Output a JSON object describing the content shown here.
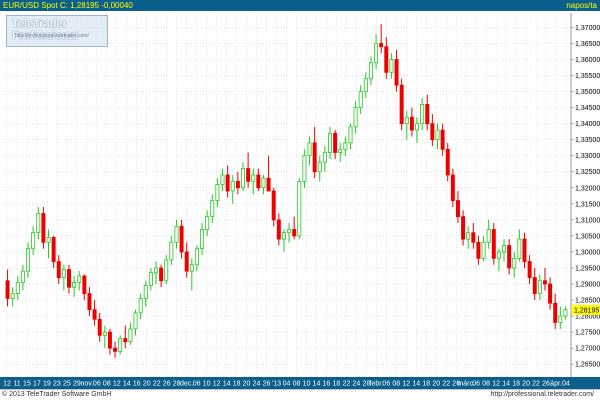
{
  "header": {
    "symbol_quote": "EUR/USD Spot  C: 1,28195 -0,00040",
    "period": "napos/ta"
  },
  "watermark": {
    "brand": "TeleTrader Professional",
    "url": "http://professional.teletrader.com/"
  },
  "footer": {
    "copyright": "© 2013 TeleTrader Software GmbH",
    "site": "http://professional.teletrader.com/"
  },
  "colors": {
    "up": "#22cc22",
    "down": "#ee0000",
    "grid": "#c8c8c8",
    "axis_band": "#0a5f8c",
    "axis_text": "#ffffff",
    "last_price_bg": "#ffff00"
  },
  "chart_data": {
    "type": "candlestick",
    "y_axis_position": "right",
    "ylim": [
      1.261,
      1.3745
    ],
    "grid": true,
    "y_ticks": [
      "1,37000",
      "1,36500",
      "1,36000",
      "1,35500",
      "1,35000",
      "1,34500",
      "1,34000",
      "1,33500",
      "1,33000",
      "1,32500",
      "1,32000",
      "1,31500",
      "1,31000",
      "1,30500",
      "1,30000",
      "1,29500",
      "1,29000",
      "1,28500",
      "1,28000",
      "1,27500",
      "1,27000",
      "1,26500"
    ],
    "x_tick_labels": [
      "12",
      "11",
      "15",
      "17",
      "19",
      "23",
      "25",
      "29",
      "nov.",
      "06",
      "08",
      "12",
      "14",
      "16",
      "20",
      "22",
      "26",
      "28",
      "dec.",
      "06",
      "10",
      "12",
      "14",
      "18",
      "20",
      "24",
      "26",
      "'13",
      "04",
      "08",
      "10",
      "14",
      "16",
      "18",
      "22",
      "24",
      "28",
      "febr.",
      "06",
      "08",
      "12",
      "14",
      "18",
      "20",
      "22",
      "26",
      "márc.",
      "06",
      "08",
      "12",
      "14",
      "18",
      "20",
      "22",
      "26",
      "ápr.",
      "04"
    ],
    "last_price": {
      "label": "1,28195",
      "value": 1.28195
    },
    "series": [
      {
        "values": [
          [
            1.291,
            1.2945,
            1.283,
            1.2855
          ],
          [
            1.2855,
            1.289,
            1.283,
            1.287
          ],
          [
            1.287,
            1.2925,
            1.285,
            1.2905
          ],
          [
            1.2905,
            1.296,
            1.288,
            1.294
          ],
          [
            1.294,
            1.303,
            1.292,
            1.301
          ],
          [
            1.301,
            1.308,
            1.299,
            1.306
          ],
          [
            1.306,
            1.314,
            1.304,
            1.312
          ],
          [
            1.312,
            1.314,
            1.301,
            1.303
          ],
          [
            1.303,
            1.307,
            1.298,
            1.3045
          ],
          [
            1.3045,
            1.305,
            1.295,
            1.297
          ],
          [
            1.297,
            1.299,
            1.29,
            1.292
          ],
          [
            1.292,
            1.296,
            1.288,
            1.2945
          ],
          [
            1.2945,
            1.296,
            1.287,
            1.289
          ],
          [
            1.289,
            1.2925,
            1.286,
            1.2905
          ],
          [
            1.2905,
            1.294,
            1.288,
            1.2925
          ],
          [
            1.2925,
            1.293,
            1.285,
            1.287
          ],
          [
            1.287,
            1.289,
            1.28,
            1.282
          ],
          [
            1.282,
            1.285,
            1.277,
            1.279
          ],
          [
            1.279,
            1.281,
            1.272,
            1.274
          ],
          [
            1.274,
            1.277,
            1.27,
            1.275
          ],
          [
            1.275,
            1.276,
            1.268,
            1.27
          ],
          [
            1.27,
            1.272,
            1.267,
            1.269
          ],
          [
            1.269,
            1.274,
            1.268,
            1.273
          ],
          [
            1.273,
            1.277,
            1.27,
            1.272
          ],
          [
            1.272,
            1.278,
            1.271,
            1.276
          ],
          [
            1.276,
            1.282,
            1.274,
            1.281
          ],
          [
            1.281,
            1.287,
            1.279,
            1.2855
          ],
          [
            1.2855,
            1.291,
            1.283,
            1.2895
          ],
          [
            1.2895,
            1.295,
            1.288,
            1.2935
          ],
          [
            1.2935,
            1.297,
            1.29,
            1.295
          ],
          [
            1.295,
            1.296,
            1.289,
            1.291
          ],
          [
            1.291,
            1.299,
            1.29,
            1.2975
          ],
          [
            1.2975,
            1.305,
            1.296,
            1.303
          ],
          [
            1.303,
            1.31,
            1.301,
            1.308
          ],
          [
            1.308,
            1.31,
            1.298,
            1.3
          ],
          [
            1.3,
            1.303,
            1.292,
            1.294
          ],
          [
            1.294,
            1.298,
            1.288,
            1.296
          ],
          [
            1.296,
            1.302,
            1.294,
            1.301
          ],
          [
            1.301,
            1.309,
            1.299,
            1.307
          ],
          [
            1.307,
            1.313,
            1.305,
            1.311
          ],
          [
            1.311,
            1.318,
            1.309,
            1.316
          ],
          [
            1.316,
            1.323,
            1.314,
            1.321
          ],
          [
            1.321,
            1.326,
            1.319,
            1.324
          ],
          [
            1.324,
            1.327,
            1.317,
            1.319
          ],
          [
            1.319,
            1.324,
            1.315,
            1.322
          ],
          [
            1.322,
            1.325,
            1.318,
            1.32
          ],
          [
            1.32,
            1.328,
            1.319,
            1.326
          ],
          [
            1.326,
            1.331,
            1.32,
            1.322
          ],
          [
            1.322,
            1.326,
            1.318,
            1.324
          ],
          [
            1.324,
            1.326,
            1.319,
            1.32
          ],
          [
            1.32,
            1.324,
            1.318,
            1.323
          ],
          [
            1.323,
            1.33,
            1.321,
            1.319
          ],
          [
            1.319,
            1.32,
            1.308,
            1.31
          ],
          [
            1.31,
            1.312,
            1.302,
            1.304
          ],
          [
            1.304,
            1.307,
            1.3,
            1.306
          ],
          [
            1.306,
            1.309,
            1.303,
            1.307
          ],
          [
            1.307,
            1.311,
            1.304,
            1.305
          ],
          [
            1.305,
            1.323,
            1.304,
            1.322
          ],
          [
            1.322,
            1.332,
            1.32,
            1.33
          ],
          [
            1.33,
            1.336,
            1.327,
            1.334
          ],
          [
            1.334,
            1.339,
            1.323,
            1.325
          ],
          [
            1.325,
            1.33,
            1.322,
            1.328
          ],
          [
            1.328,
            1.333,
            1.325,
            1.331
          ],
          [
            1.331,
            1.339,
            1.329,
            1.337
          ],
          [
            1.337,
            1.338,
            1.329,
            1.331
          ],
          [
            1.331,
            1.334,
            1.328,
            1.332
          ],
          [
            1.332,
            1.336,
            1.33,
            1.334
          ],
          [
            1.334,
            1.34,
            1.332,
            1.339
          ],
          [
            1.339,
            1.347,
            1.337,
            1.345
          ],
          [
            1.345,
            1.352,
            1.343,
            1.35
          ],
          [
            1.35,
            1.356,
            1.348,
            1.354
          ],
          [
            1.354,
            1.361,
            1.352,
            1.359
          ],
          [
            1.359,
            1.368,
            1.357,
            1.365
          ],
          [
            1.365,
            1.371,
            1.362,
            1.364
          ],
          [
            1.364,
            1.367,
            1.354,
            1.356
          ],
          [
            1.356,
            1.362,
            1.354,
            1.36
          ],
          [
            1.36,
            1.363,
            1.35,
            1.352
          ],
          [
            1.352,
            1.354,
            1.338,
            1.34
          ],
          [
            1.34,
            1.344,
            1.335,
            1.342
          ],
          [
            1.342,
            1.345,
            1.336,
            1.338
          ],
          [
            1.338,
            1.342,
            1.334,
            1.34
          ],
          [
            1.34,
            1.348,
            1.338,
            1.346
          ],
          [
            1.346,
            1.349,
            1.338,
            1.34
          ],
          [
            1.34,
            1.343,
            1.333,
            1.335
          ],
          [
            1.335,
            1.34,
            1.332,
            1.338
          ],
          [
            1.338,
            1.34,
            1.33,
            1.332
          ],
          [
            1.332,
            1.334,
            1.322,
            1.324
          ],
          [
            1.324,
            1.326,
            1.314,
            1.316
          ],
          [
            1.316,
            1.319,
            1.309,
            1.311
          ],
          [
            1.311,
            1.313,
            1.302,
            1.304
          ],
          [
            1.304,
            1.308,
            1.301,
            1.306
          ],
          [
            1.306,
            1.309,
            1.301,
            1.303
          ],
          [
            1.303,
            1.305,
            1.296,
            1.298
          ],
          [
            1.298,
            1.305,
            1.297,
            1.303
          ],
          [
            1.303,
            1.31,
            1.301,
            1.307
          ],
          [
            1.307,
            1.309,
            1.296,
            1.298
          ],
          [
            1.298,
            1.301,
            1.294,
            1.3
          ],
          [
            1.3,
            1.304,
            1.297,
            1.302
          ],
          [
            1.302,
            1.304,
            1.293,
            1.295
          ],
          [
            1.295,
            1.3,
            1.292,
            1.298
          ],
          [
            1.298,
            1.307,
            1.297,
            1.304
          ],
          [
            1.304,
            1.306,
            1.295,
            1.297
          ],
          [
            1.297,
            1.299,
            1.29,
            1.292
          ],
          [
            1.292,
            1.295,
            1.285,
            1.287
          ],
          [
            1.287,
            1.293,
            1.285,
            1.291
          ],
          [
            1.291,
            1.295,
            1.288,
            1.29
          ],
          [
            1.29,
            1.292,
            1.282,
            1.284
          ],
          [
            1.284,
            1.287,
            1.276,
            1.278
          ],
          [
            1.278,
            1.283,
            1.276,
            1.28
          ],
          [
            1.28,
            1.283,
            1.279,
            1.282
          ]
        ]
      }
    ]
  }
}
